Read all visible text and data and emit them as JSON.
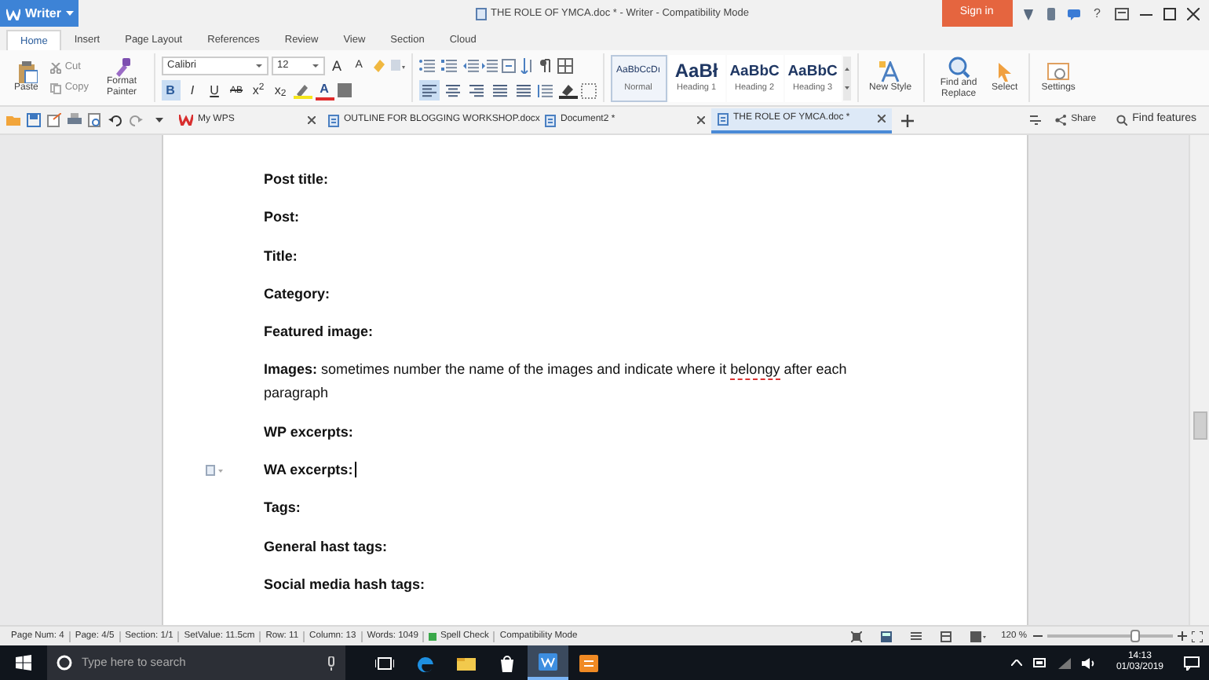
{
  "app_button": "Writer",
  "window": {
    "title": "THE ROLE OF YMCA.doc * - Writer - Compatibility Mode"
  },
  "sign_in": "Sign in",
  "help": "?",
  "menu_tabs": [
    {
      "label": "Home",
      "selected": true
    },
    {
      "label": "Insert",
      "selected": false
    },
    {
      "label": "Page Layout",
      "selected": false
    },
    {
      "label": "References",
      "selected": false
    },
    {
      "label": "Review",
      "selected": false
    },
    {
      "label": "View",
      "selected": false
    },
    {
      "label": "Section",
      "selected": false
    },
    {
      "label": "Cloud",
      "selected": false
    }
  ],
  "ribbon": {
    "paste": "Paste",
    "cut": "Cut",
    "copy": "Copy",
    "format_painter": "Format Painter",
    "font_name": "Calibri",
    "font_size": "12",
    "size_buttons": [
      {
        "kind": "grow",
        "label": "A"
      },
      {
        "kind": "shrink",
        "label": "A"
      }
    ],
    "font_buttons": [
      {
        "kind": "bold",
        "label": "B",
        "on": true
      },
      {
        "kind": "italic",
        "label": "I",
        "on": false
      },
      {
        "kind": "underline",
        "label": "U",
        "on": false
      },
      {
        "kind": "strike",
        "label": "AB",
        "on": false
      },
      {
        "kind": "superscript",
        "label": "x$^{2}$",
        "on": false
      },
      {
        "kind": "subscript",
        "label": "x$_{2}$",
        "on": false
      }
    ],
    "font_color": "A",
    "alignment": [
      {
        "kind": "left",
        "selected": true
      },
      {
        "kind": "center",
        "selected": false
      },
      {
        "kind": "right",
        "selected": false
      },
      {
        "kind": "justify",
        "selected": false
      },
      {
        "kind": "distributed",
        "selected": false
      }
    ],
    "styles": [
      {
        "preview": "AaBbCcDı",
        "label": "Normal",
        "selected": true
      },
      {
        "preview": "AaBł",
        "label": "Heading 1",
        "selected": false
      },
      {
        "preview": "AaBbC",
        "label": "Heading 2",
        "selected": false
      },
      {
        "preview": "AaBbC",
        "label": "Heading 3",
        "selected": false
      }
    ],
    "new_style": "New Style",
    "find_replace": "Find and Replace",
    "select": "Select",
    "settings": "Settings"
  },
  "doc_tabs": [
    {
      "label": "My WPS",
      "kind": "home",
      "selected": false
    },
    {
      "label": "OUTLINE FOR BLOGGING WORKSHOP.docx",
      "kind": "doc",
      "selected": false
    },
    {
      "label": "Document2 *",
      "kind": "doc",
      "selected": false
    },
    {
      "label": "THE ROLE OF YMCA.doc *",
      "kind": "doc",
      "selected": true
    }
  ],
  "share": "Share",
  "find_features": "Find features",
  "document": {
    "paragraphs": [
      {
        "label": "Post title:"
      },
      {
        "label": "Post:"
      },
      {
        "label": "Title:"
      },
      {
        "label": "Category:"
      },
      {
        "label": "Featured image:"
      },
      {
        "label": "Images:",
        "body": [
          {
            "text": "sometimes number the name of the images and indicate where it ",
            "misspelled": false
          },
          {
            "text": "belongy",
            "misspelled": true
          },
          {
            "text": " after each paragraph",
            "misspelled": false
          }
        ]
      },
      {
        "label": "WP excerpts:"
      },
      {
        "label": "WA excerpts:",
        "cursor": true
      },
      {
        "label": "Tags:"
      },
      {
        "label": "General hast tags:"
      },
      {
        "label": "Social media hash tags:"
      }
    ]
  },
  "status_bar": {
    "items": [
      "Page Num: 4",
      "Page: 4/5",
      "Section: 1/1",
      "SetValue: 11.5cm",
      "Row: 11",
      "Column: 13",
      "Words: 1049"
    ],
    "spell_check": "Spell Check",
    "mode": "Compatibility Mode",
    "zoom": "120 %",
    "level": 0.7
  },
  "taskbar": {
    "search_placeholder": "Type here to search",
    "apps": [
      {
        "kind": "taskview",
        "selected": false
      },
      {
        "kind": "edge",
        "selected": false
      },
      {
        "kind": "explorer",
        "selected": false
      },
      {
        "kind": "store",
        "selected": false
      },
      {
        "kind": "writer",
        "selected": true
      },
      {
        "kind": "orange",
        "selected": false
      }
    ],
    "time": "14:13",
    "date": "01/03/2019"
  }
}
